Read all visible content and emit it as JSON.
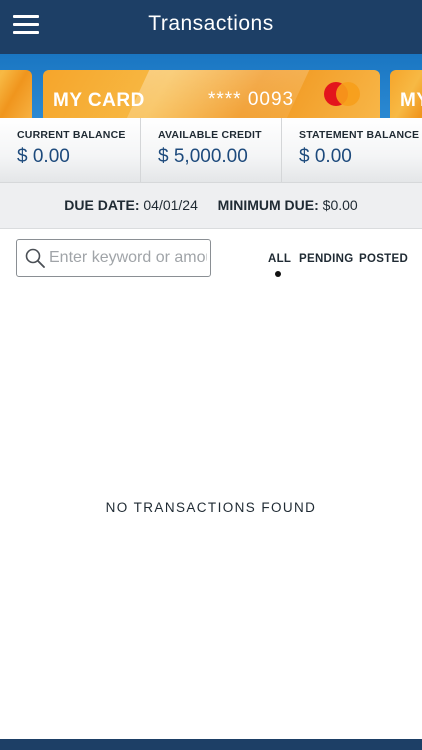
{
  "header": {
    "title": "Transactions",
    "menu_icon": "hamburger-menu-icon"
  },
  "cards": {
    "left_partial": {
      "name": ""
    },
    "main": {
      "name": "MY CARD",
      "number": "**** 0093",
      "network_icon": "mastercard-logo-icon"
    },
    "right_partial": {
      "name": "MY"
    }
  },
  "balances": {
    "current": {
      "label": "CURRENT BALANCE",
      "value": "$ 0.00"
    },
    "available": {
      "label": "AVAILABLE CREDIT",
      "value": "$ 5,000.00"
    },
    "statement": {
      "label": "STATEMENT BALANCE",
      "value": "$ 0.00"
    }
  },
  "due": {
    "due_date_label": "DUE DATE:",
    "due_date_value": "04/01/24",
    "minimum_due_label": "MINIMUM DUE:",
    "minimum_due_value": "$0.00"
  },
  "search": {
    "placeholder": "Enter keyword or amount",
    "value": "",
    "icon": "search-icon"
  },
  "filters": {
    "all": "ALL",
    "pending": "PENDING",
    "posted": "POSTED",
    "selected": "ALL"
  },
  "empty_message": "NO TRANSACTIONS FOUND",
  "colors": {
    "header": "#1d3f66",
    "card": "#f6a52b",
    "balance_value": "#1d4a7c"
  }
}
